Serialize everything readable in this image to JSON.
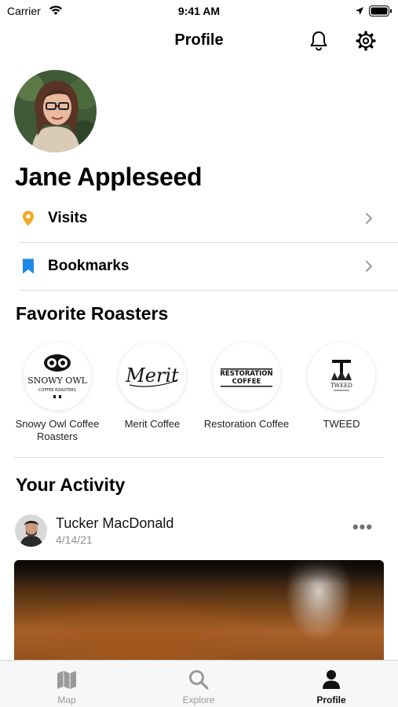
{
  "status_bar": {
    "carrier": "Carrier",
    "time": "9:41 AM"
  },
  "nav": {
    "title": "Profile"
  },
  "profile": {
    "name": "Jane Appleseed"
  },
  "menu": [
    {
      "label": "Visits",
      "icon": "location-pin-icon",
      "color": "#F5A623"
    },
    {
      "label": "Bookmarks",
      "icon": "bookmark-icon",
      "color": "#1E88E5"
    }
  ],
  "favorites": {
    "title": "Favorite Roasters",
    "roasters": [
      {
        "name": "Snowy Owl Coffee Roasters",
        "logo_line1": "SNOWY OWL",
        "logo_line2": "COFFEE ROASTERS"
      },
      {
        "name": "Merit Coffee",
        "logo_text": "Merit"
      },
      {
        "name": "Restoration Coffee",
        "logo_line1": "RESTORATION",
        "logo_line2": "COFFEE"
      },
      {
        "name": "TWEED",
        "logo_text": "TWEED"
      }
    ]
  },
  "activity": {
    "title": "Your Activity",
    "post": {
      "author": "Tucker MacDonald",
      "date": "4/14/21",
      "more": "•••"
    }
  },
  "tabs": [
    {
      "label": "Map",
      "icon": "map-icon",
      "active": false
    },
    {
      "label": "Explore",
      "icon": "search-icon",
      "active": false
    },
    {
      "label": "Profile",
      "icon": "person-icon",
      "active": true
    }
  ]
}
